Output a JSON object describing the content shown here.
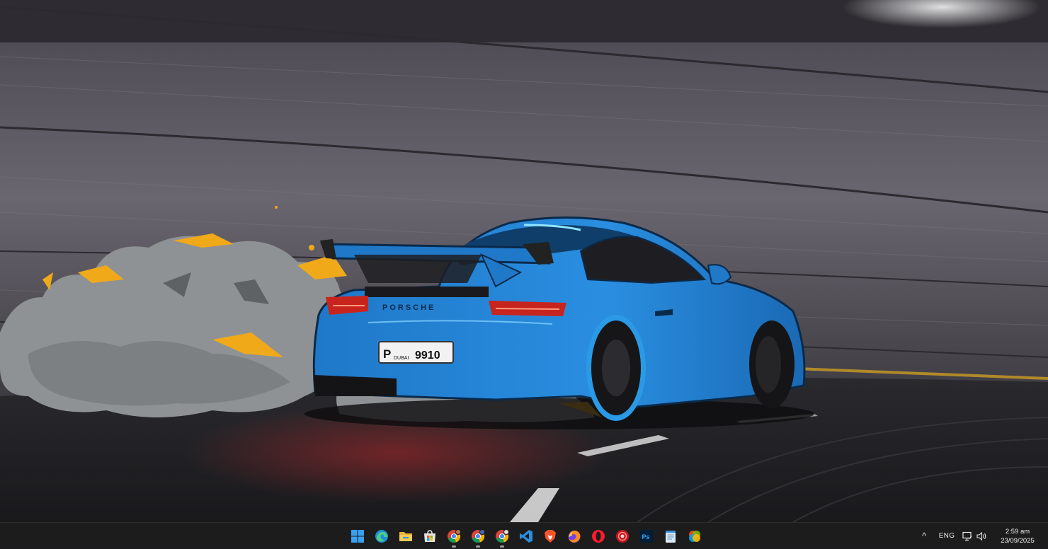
{
  "wallpaper": {
    "plate_prefix": "P",
    "plate_city": "DUBAI",
    "plate_number": "9910",
    "badge": "PORSCHE"
  },
  "taskbar": {
    "apps": [
      {
        "name": "start-button-icon",
        "running": false
      },
      {
        "name": "edge-icon",
        "running": false
      },
      {
        "name": "file-explorer-icon",
        "running": false
      },
      {
        "name": "microsoft-store-icon",
        "running": false
      },
      {
        "name": "chrome-profile-1-icon",
        "running": true
      },
      {
        "name": "chrome-profile-2-icon",
        "running": true
      },
      {
        "name": "chrome-profile-3-icon",
        "running": true
      },
      {
        "name": "vscode-icon",
        "running": false
      },
      {
        "name": "brave-icon",
        "running": false
      },
      {
        "name": "firefox-icon",
        "running": false
      },
      {
        "name": "opera-icon",
        "running": false
      },
      {
        "name": "recorder-icon",
        "running": false
      },
      {
        "name": "photoshop-icon",
        "running": false
      },
      {
        "name": "notepad-icon",
        "running": false
      },
      {
        "name": "colorful-app-icon",
        "running": false
      }
    ],
    "tray": {
      "chevron": "^",
      "language": "ENG",
      "time": "2:59 am",
      "date": "23/09/2025"
    }
  }
}
